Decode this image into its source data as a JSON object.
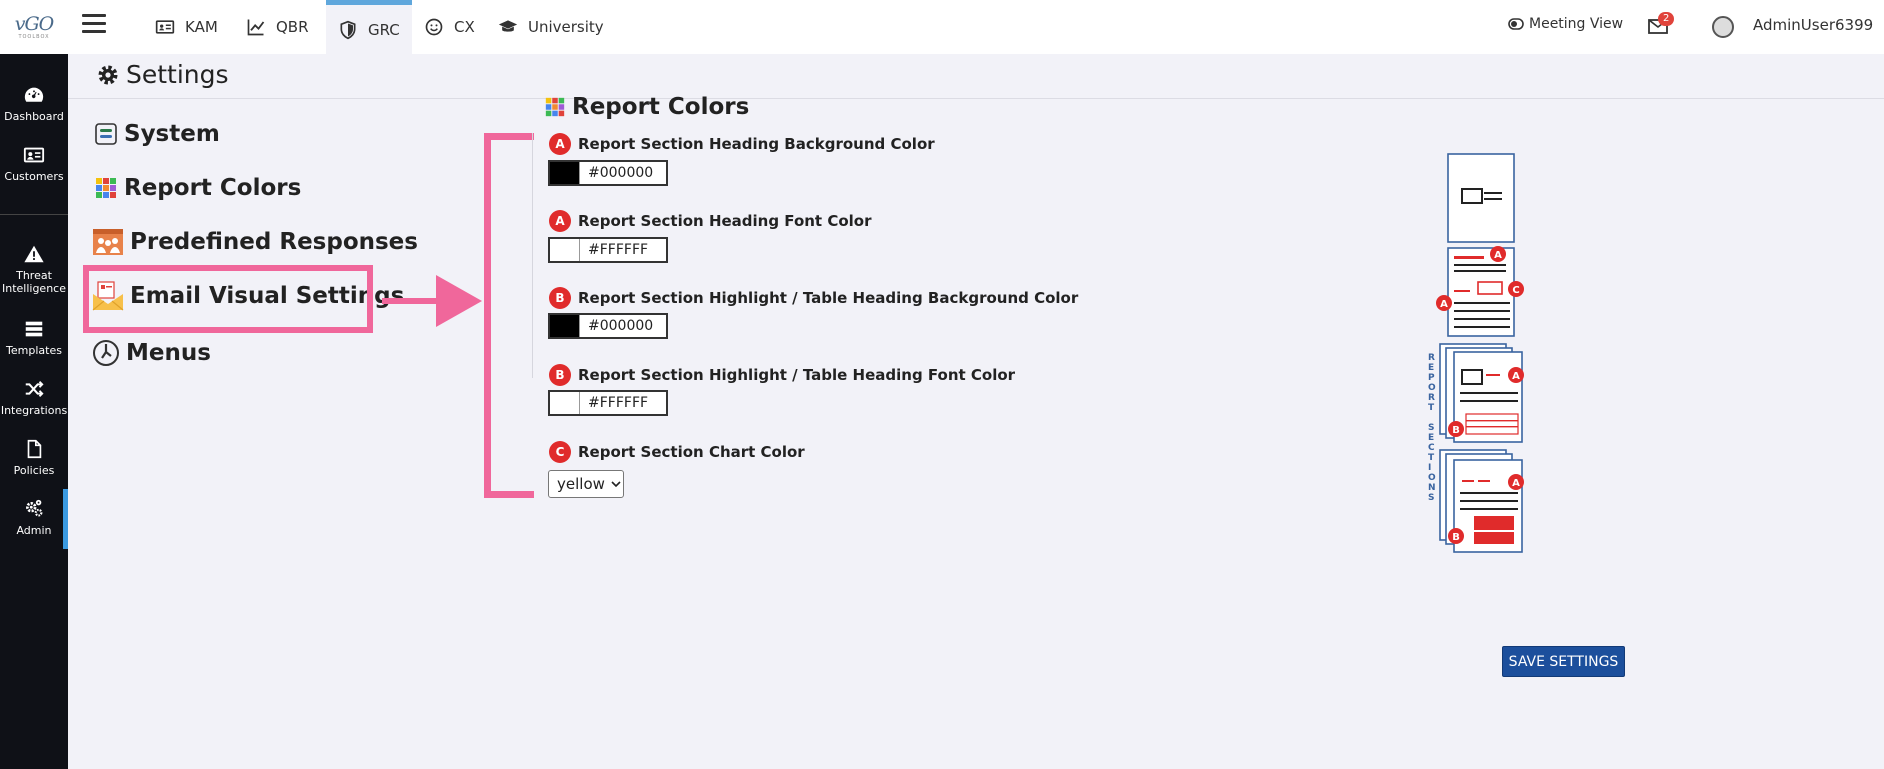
{
  "app": {
    "logo_text": "vGO",
    "logo_sub": "TOOLBOX"
  },
  "rail": {
    "items": [
      {
        "label": "Dashboard",
        "icon": "dashboard-icon"
      },
      {
        "label": "Customers",
        "icon": "customers-icon"
      },
      {
        "label": "Threat Intelligence",
        "icon": "warning-icon"
      },
      {
        "label": "Templates",
        "icon": "templates-icon"
      },
      {
        "label": "Integrations",
        "icon": "shuffle-icon"
      },
      {
        "label": "Policies",
        "icon": "document-icon"
      },
      {
        "label": "Admin",
        "icon": "gears-icon"
      }
    ],
    "active": "Admin"
  },
  "topbar": {
    "tabs": [
      {
        "label": "KAM",
        "icon": "id-card-icon"
      },
      {
        "label": "QBR",
        "icon": "chart-line-icon"
      },
      {
        "label": "GRC",
        "icon": "shield-icon"
      },
      {
        "label": "CX",
        "icon": "smile-icon"
      },
      {
        "label": "University",
        "icon": "graduation-cap-icon"
      }
    ],
    "active_tab": "GRC",
    "meeting_view": "Meeting View",
    "mail_count": "2",
    "username": "AdminUser6399"
  },
  "page": {
    "title": "Settings"
  },
  "menu": {
    "items": [
      {
        "label": "System",
        "icon": "system-icon"
      },
      {
        "label": "Report Colors",
        "icon": "palette-grid-icon"
      },
      {
        "label": "Predefined Responses",
        "icon": "responses-icon"
      },
      {
        "label": "Email Visual Settings",
        "icon": "email-icon"
      },
      {
        "label": "Menus",
        "icon": "menus-icon"
      }
    ],
    "highlighted": "Email Visual Settings"
  },
  "report_colors": {
    "title": "Report Colors",
    "fields": [
      {
        "badge": "A",
        "label": "Report Section Heading Background Color",
        "value": "#000000",
        "swatch": "#000000"
      },
      {
        "badge": "A",
        "label": "Report Section Heading Font Color",
        "value": "#FFFFFF",
        "swatch": "#FFFFFF"
      },
      {
        "badge": "B",
        "label": "Report Section Highlight / Table Heading Background Color",
        "value": "#000000",
        "swatch": "#000000"
      },
      {
        "badge": "B",
        "label": "Report Section Highlight / Table Heading Font Color",
        "value": "#FFFFFF",
        "swatch": "#FFFFFF"
      }
    ],
    "chart_color": {
      "badge": "C",
      "label": "Report Section Chart Color",
      "selected": "yellow"
    }
  },
  "illustration": {
    "side_label": "REPORT SECTIONS",
    "badges": [
      "A",
      "A",
      "C",
      "A",
      "B",
      "A",
      "B"
    ]
  },
  "actions": {
    "save_label": "SAVE SETTINGS"
  },
  "colors": {
    "accent_pink": "#f0679b",
    "badge_red": "#e02b2b",
    "save_blue": "#1c4f9c",
    "rail_bg": "#0f1117"
  }
}
